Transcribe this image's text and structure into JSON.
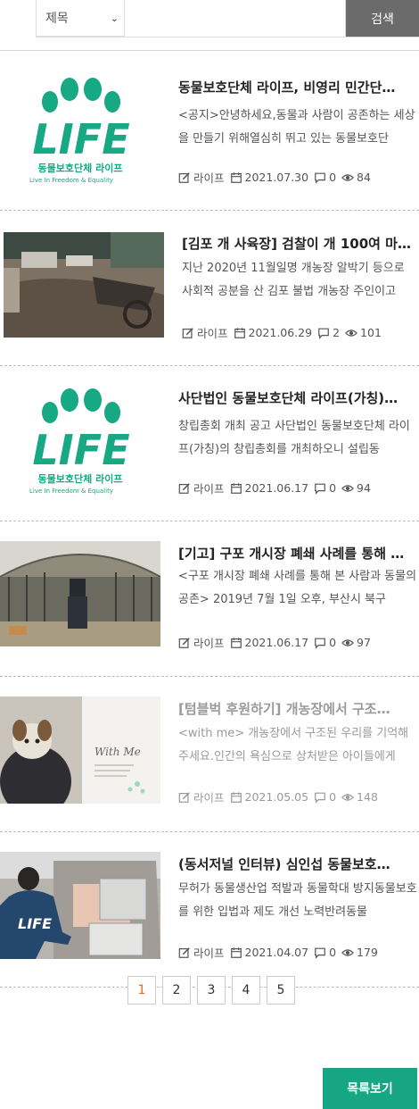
{
  "search": {
    "select_value": "제목",
    "input_value": "",
    "button_label": "검색"
  },
  "colors": {
    "accent": "#16a683",
    "active_page": "#e06a1e",
    "search_button": "#6b6b6b"
  },
  "posts": [
    {
      "title": "동물보호단체 라이프, 비영리 민간단…",
      "excerpt": "<공지>안녕하세요,동물과 사람이 공존하는 세상을 만들기 위해열심히 뛰고 있는 동물보호단",
      "author": "라이프",
      "date": "2021.07.30",
      "comments": "0",
      "views": "84",
      "thumb": {
        "type": "life-logo",
        "logo_text": "LIFE",
        "logo_name": "동물보호단체 라이프",
        "logo_tagline": "Live In Freedom & Equality"
      }
    },
    {
      "title": "[김포 개 사육장] 검찰이 개 100여 마…",
      "excerpt": "지난 2020년 11월일명 개농장 알박기 등으로 사회적 공분을 산 김포 불법 개농장 주인이고",
      "author": "라이프",
      "date": "2021.06.29",
      "comments": "2",
      "views": "101",
      "thumb": {
        "type": "photo-farm"
      }
    },
    {
      "title": "사단법인 동물보호단체 라이프(가칭)…",
      "excerpt": "창립총회 개최 공고   사단법인 동물보호단체 라이프(가칭)의 창립총회를 개최하오니 설립동",
      "author": "라이프",
      "date": "2021.06.17",
      "comments": "0",
      "views": "94",
      "thumb": {
        "type": "life-logo",
        "logo_text": "LIFE",
        "logo_name": "동물보호단체 라이프",
        "logo_tagline": "Live In Freedom & Equality"
      }
    },
    {
      "title": "[기고] 구포 개시장 폐쇄 사례를 통해 …",
      "excerpt": "<구포 개시장 폐쇄 사례를 통해 본 사람과 동물의 공존> 2019년 7월 1일 오후, 부산시 북구",
      "author": "라이프",
      "date": "2021.06.17",
      "comments": "0",
      "views": "97",
      "thumb": {
        "type": "photo-greenhouse"
      }
    },
    {
      "title": "[텀블벅 후원하기] 개농장에서 구조…",
      "excerpt": "<with me> 개농장에서 구조된 우리를 기억해주세요.인간의 욕심으로 상처받은 아이들에게",
      "author": "라이프",
      "date": "2021.05.05",
      "comments": "0",
      "views": "148",
      "thumb": {
        "type": "photo-withme",
        "card_text": "With Me"
      }
    },
    {
      "title": "(동서저널 인터뷰) 심인섭 동물보호…",
      "excerpt": "무허가 동물생산업 적발과 동물학대 방지동물보호를 위한 입법과 제도 개선 노력반려동물",
      "author": "라이프",
      "date": "2021.04.07",
      "comments": "0",
      "views": "179",
      "thumb": {
        "type": "photo-car"
      }
    }
  ],
  "pagination": {
    "pages": [
      "1",
      "2",
      "3",
      "4",
      "5"
    ],
    "active": "1"
  },
  "list_button_label": "목록보기"
}
